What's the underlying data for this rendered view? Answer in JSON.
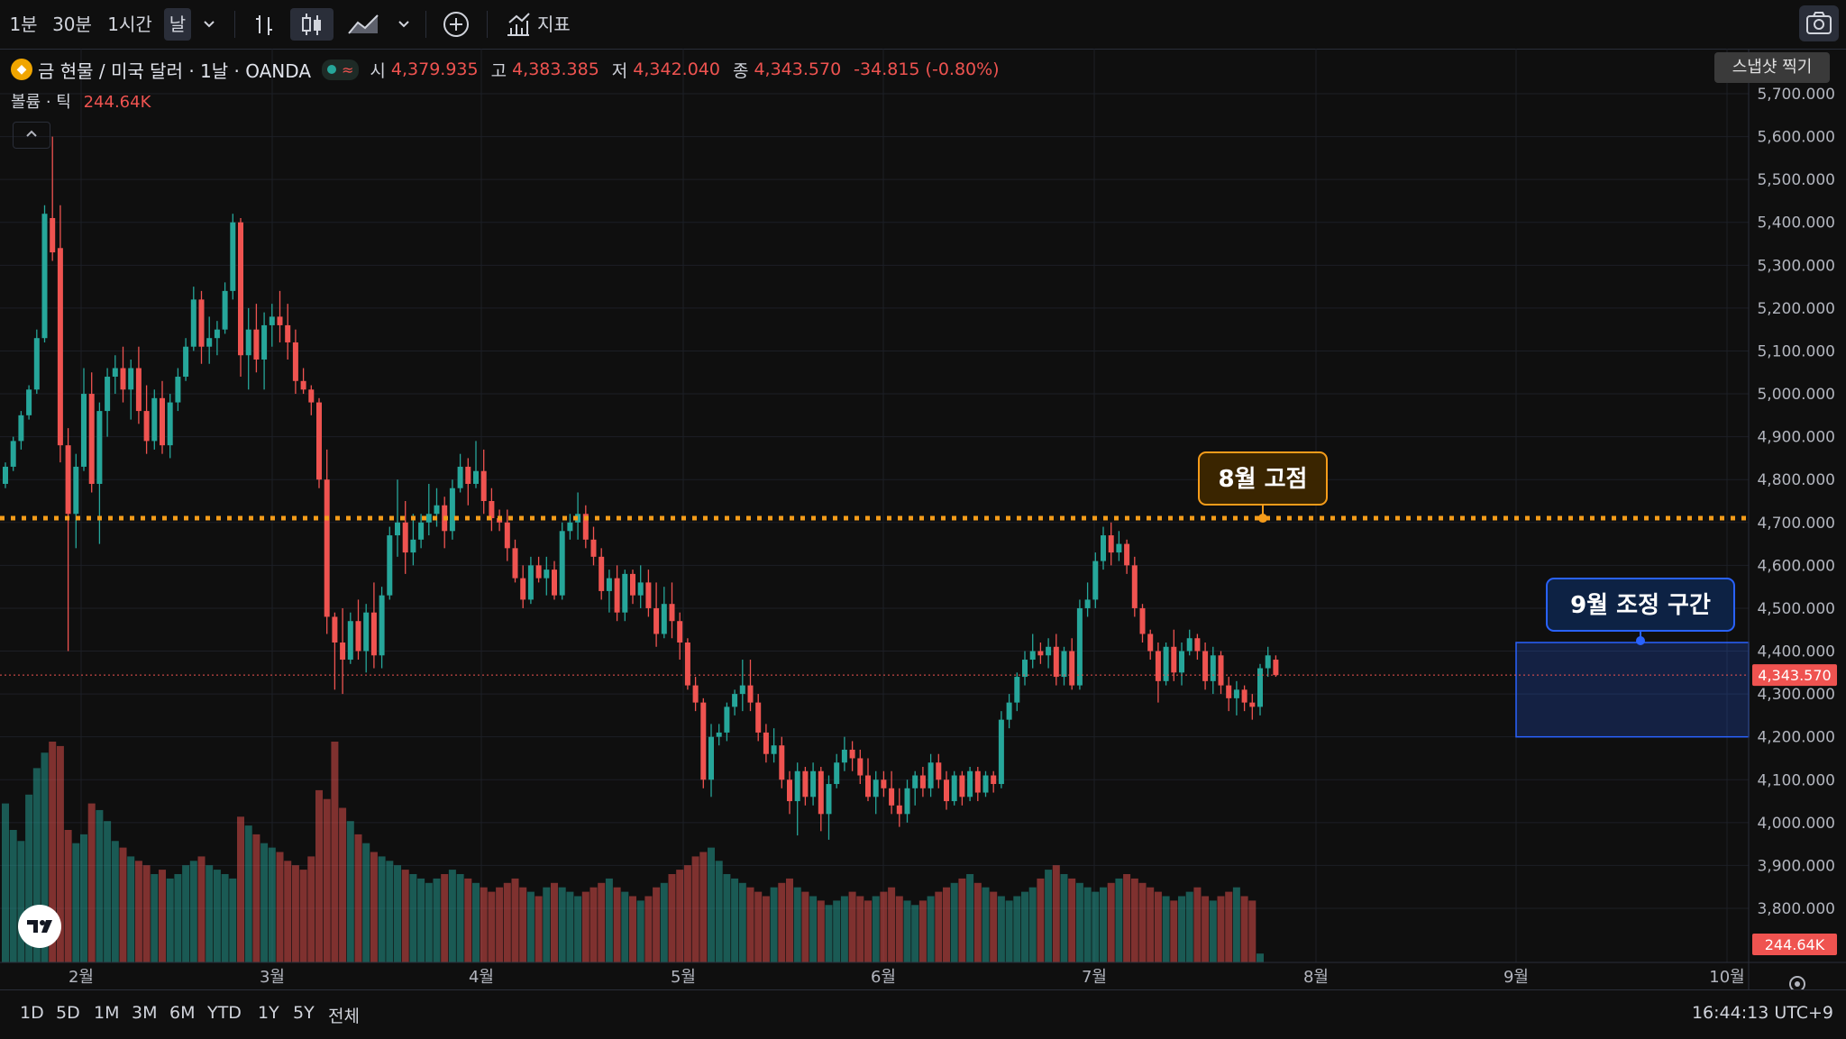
{
  "toolbar": {
    "intervals": [
      "1분",
      "30분",
      "1시간",
      "날"
    ],
    "indicators_label": "지표",
    "icons": [
      "chevron-down-icon",
      "bar-style-icon",
      "candle-style-icon",
      "area-style-icon",
      "chevron-down-icon",
      "add-compare-icon",
      "indicators-icon",
      "camera-icon"
    ]
  },
  "legend": {
    "symbol": "금 현물 / 미국 달러 · 1날 · OANDA",
    "open_label": "시",
    "open": "4,379.935",
    "high_label": "고",
    "high": "4,383.385",
    "low_label": "저",
    "low": "4,342.040",
    "close_label": "종",
    "close": "4,343.570",
    "change": "-34.815 (-0.80%)"
  },
  "volume": {
    "label": "볼륨 · 틱",
    "value": "244.64K"
  },
  "snapshot_tooltip": "스냅샷 찍기",
  "annotations": {
    "aug_high": "8월 고점",
    "sep_correction": "9월 조정 구간"
  },
  "price_axis": {
    "labels": [
      "5,700.000",
      "5,600.000",
      "5,500.000",
      "5,400.000",
      "5,300.000",
      "5,200.000",
      "5,100.000",
      "5,000.000",
      "4,900.000",
      "4,800.000",
      "4,700.000",
      "4,600.000",
      "4,500.000",
      "4,400.000",
      "4,300.000",
      "4,200.000",
      "4,100.000",
      "4,000.000",
      "3,900.000",
      "3,800.000"
    ],
    "last_price": "4,343.570",
    "last_volume": "244.64K"
  },
  "time_axis": [
    "2월",
    "3월",
    "4월",
    "5월",
    "6월",
    "7월",
    "8월",
    "9월",
    "10월"
  ],
  "bottom_bar": {
    "ranges": [
      "1D",
      "5D",
      "1M",
      "3M",
      "6M",
      "YTD",
      "1Y",
      "5Y",
      "전체"
    ],
    "clock": "16:44:13 UTC+9"
  },
  "colors": {
    "up": "#26a69a",
    "down": "#ef5350",
    "accent": "#f59c1a",
    "zone": "#2962ff"
  },
  "chart_data": {
    "type": "candlestick",
    "title": "금 현물 / 미국 달러 · 1날 · OANDA",
    "ylim": [
      3800,
      5700
    ],
    "resistance_level": 4710,
    "correction_zone": {
      "price_low": 4200,
      "price_high": 4420
    },
    "candles_ohlc": [
      [
        4790,
        4840,
        4780,
        4830
      ],
      [
        4830,
        4900,
        4820,
        4890
      ],
      [
        4890,
        4960,
        4870,
        4950
      ],
      [
        4950,
        5020,
        4940,
        5010
      ],
      [
        5010,
        5150,
        5000,
        5130
      ],
      [
        5130,
        5440,
        5120,
        5420
      ],
      [
        5410,
        5600,
        5310,
        5330
      ],
      [
        5340,
        5440,
        4840,
        4880
      ],
      [
        4880,
        4920,
        4400,
        4720
      ],
      [
        4720,
        4860,
        4640,
        4830
      ],
      [
        4830,
        5060,
        4820,
        5000
      ],
      [
        5000,
        5050,
        4770,
        4790
      ],
      [
        4790,
        4980,
        4650,
        4960
      ],
      [
        4960,
        5060,
        4900,
        5040
      ],
      [
        5040,
        5090,
        5000,
        5060
      ],
      [
        5060,
        5110,
        4980,
        5010
      ],
      [
        5010,
        5080,
        4940,
        5060
      ],
      [
        5060,
        5110,
        4930,
        4960
      ],
      [
        4960,
        5020,
        4860,
        4890
      ],
      [
        4890,
        5010,
        4870,
        4990
      ],
      [
        4990,
        5030,
        4860,
        4880
      ],
      [
        4880,
        5000,
        4850,
        4980
      ],
      [
        4980,
        5060,
        4960,
        5040
      ],
      [
        5040,
        5130,
        5030,
        5110
      ],
      [
        5110,
        5250,
        5100,
        5220
      ],
      [
        5220,
        5240,
        5070,
        5110
      ],
      [
        5110,
        5180,
        5070,
        5130
      ],
      [
        5130,
        5170,
        5090,
        5150
      ],
      [
        5150,
        5260,
        5140,
        5240
      ],
      [
        5240,
        5420,
        5220,
        5400
      ],
      [
        5400,
        5410,
        5040,
        5090
      ],
      [
        5090,
        5200,
        5010,
        5150
      ],
      [
        5150,
        5210,
        5050,
        5080
      ],
      [
        5080,
        5190,
        5010,
        5160
      ],
      [
        5160,
        5210,
        5110,
        5180
      ],
      [
        5180,
        5240,
        5120,
        5160
      ],
      [
        5160,
        5210,
        5080,
        5120
      ],
      [
        5120,
        5150,
        5000,
        5030
      ],
      [
        5030,
        5060,
        5000,
        5010
      ],
      [
        5010,
        5020,
        4950,
        4980
      ],
      [
        4980,
        4990,
        4780,
        4800
      ],
      [
        4800,
        4870,
        4440,
        4480
      ],
      [
        4480,
        4490,
        4310,
        4420
      ],
      [
        4420,
        4500,
        4300,
        4380
      ],
      [
        4380,
        4490,
        4370,
        4470
      ],
      [
        4470,
        4520,
        4380,
        4400
      ],
      [
        4400,
        4510,
        4350,
        4490
      ],
      [
        4490,
        4560,
        4360,
        4390
      ],
      [
        4390,
        4550,
        4360,
        4530
      ],
      [
        4530,
        4690,
        4520,
        4670
      ],
      [
        4670,
        4800,
        4620,
        4700
      ],
      [
        4700,
        4750,
        4580,
        4630
      ],
      [
        4630,
        4720,
        4600,
        4660
      ],
      [
        4660,
        4720,
        4640,
        4700
      ],
      [
        4700,
        4790,
        4670,
        4720
      ],
      [
        4720,
        4780,
        4690,
        4740
      ],
      [
        4740,
        4760,
        4640,
        4680
      ],
      [
        4680,
        4800,
        4660,
        4780
      ],
      [
        4780,
        4860,
        4770,
        4830
      ],
      [
        4830,
        4850,
        4740,
        4790
      ],
      [
        4790,
        4890,
        4780,
        4820
      ],
      [
        4820,
        4870,
        4720,
        4750
      ],
      [
        4750,
        4780,
        4680,
        4710
      ],
      [
        4710,
        4730,
        4680,
        4700
      ],
      [
        4700,
        4730,
        4610,
        4640
      ],
      [
        4640,
        4660,
        4560,
        4570
      ],
      [
        4570,
        4600,
        4500,
        4520
      ],
      [
        4520,
        4620,
        4510,
        4600
      ],
      [
        4600,
        4620,
        4560,
        4570
      ],
      [
        4570,
        4620,
        4530,
        4590
      ],
      [
        4590,
        4610,
        4520,
        4530
      ],
      [
        4530,
        4700,
        4520,
        4680
      ],
      [
        4680,
        4720,
        4660,
        4700
      ],
      [
        4700,
        4770,
        4660,
        4720
      ],
      [
        4720,
        4740,
        4640,
        4660
      ],
      [
        4660,
        4690,
        4600,
        4620
      ],
      [
        4620,
        4640,
        4520,
        4540
      ],
      [
        4540,
        4590,
        4490,
        4570
      ],
      [
        4570,
        4600,
        4470,
        4490
      ],
      [
        4490,
        4590,
        4470,
        4580
      ],
      [
        4580,
        4590,
        4510,
        4530
      ],
      [
        4530,
        4600,
        4500,
        4560
      ],
      [
        4560,
        4590,
        4480,
        4500
      ],
      [
        4500,
        4560,
        4410,
        4440
      ],
      [
        4440,
        4550,
        4430,
        4510
      ],
      [
        4510,
        4560,
        4430,
        4470
      ],
      [
        4470,
        4490,
        4380,
        4420
      ],
      [
        4420,
        4430,
        4310,
        4320
      ],
      [
        4320,
        4340,
        4260,
        4280
      ],
      [
        4280,
        4290,
        4080,
        4100
      ],
      [
        4100,
        4230,
        4060,
        4200
      ],
      [
        4200,
        4230,
        4180,
        4210
      ],
      [
        4210,
        4280,
        4190,
        4270
      ],
      [
        4270,
        4310,
        4250,
        4300
      ],
      [
        4300,
        4380,
        4260,
        4320
      ],
      [
        4320,
        4380,
        4260,
        4280
      ],
      [
        4280,
        4300,
        4190,
        4210
      ],
      [
        4210,
        4230,
        4140,
        4160
      ],
      [
        4160,
        4220,
        4140,
        4180
      ],
      [
        4180,
        4200,
        4080,
        4100
      ],
      [
        4100,
        4120,
        4020,
        4050
      ],
      [
        4050,
        4140,
        3970,
        4120
      ],
      [
        4120,
        4130,
        4040,
        4060
      ],
      [
        4060,
        4140,
        4040,
        4120
      ],
      [
        4120,
        4130,
        3980,
        4020
      ],
      [
        4020,
        4110,
        3960,
        4090
      ],
      [
        4090,
        4160,
        4080,
        4140
      ],
      [
        4140,
        4200,
        4120,
        4170
      ],
      [
        4170,
        4190,
        4120,
        4150
      ],
      [
        4150,
        4170,
        4090,
        4110
      ],
      [
        4110,
        4150,
        4050,
        4060
      ],
      [
        4060,
        4120,
        4020,
        4100
      ],
      [
        4100,
        4120,
        4060,
        4080
      ],
      [
        4080,
        4120,
        4020,
        4040
      ],
      [
        4040,
        4080,
        3990,
        4020
      ],
      [
        4020,
        4100,
        4000,
        4080
      ],
      [
        4080,
        4120,
        4040,
        4110
      ],
      [
        4110,
        4130,
        4060,
        4080
      ],
      [
        4080,
        4160,
        4060,
        4140
      ],
      [
        4140,
        4160,
        4080,
        4100
      ],
      [
        4100,
        4120,
        4030,
        4050
      ],
      [
        4050,
        4120,
        4040,
        4110
      ],
      [
        4110,
        4120,
        4040,
        4060
      ],
      [
        4060,
        4130,
        4050,
        4120
      ],
      [
        4120,
        4130,
        4050,
        4070
      ],
      [
        4070,
        4120,
        4060,
        4110
      ],
      [
        4110,
        4120,
        4070,
        4090
      ],
      [
        4090,
        4260,
        4080,
        4240
      ],
      [
        4240,
        4300,
        4220,
        4280
      ],
      [
        4280,
        4350,
        4260,
        4340
      ],
      [
        4340,
        4400,
        4320,
        4380
      ],
      [
        4380,
        4440,
        4360,
        4400
      ],
      [
        4400,
        4420,
        4370,
        4390
      ],
      [
        4390,
        4430,
        4360,
        4410
      ],
      [
        4410,
        4440,
        4320,
        4340
      ],
      [
        4340,
        4410,
        4320,
        4400
      ],
      [
        4400,
        4430,
        4310,
        4320
      ],
      [
        4320,
        4520,
        4310,
        4500
      ],
      [
        4500,
        4560,
        4480,
        4520
      ],
      [
        4520,
        4630,
        4500,
        4610
      ],
      [
        4610,
        4690,
        4590,
        4670
      ],
      [
        4670,
        4700,
        4600,
        4630
      ],
      [
        4630,
        4680,
        4610,
        4650
      ],
      [
        4650,
        4660,
        4580,
        4600
      ],
      [
        4600,
        4620,
        4480,
        4500
      ],
      [
        4500,
        4510,
        4420,
        4440
      ],
      [
        4440,
        4450,
        4380,
        4400
      ],
      [
        4400,
        4420,
        4280,
        4330
      ],
      [
        4330,
        4420,
        4320,
        4410
      ],
      [
        4410,
        4450,
        4330,
        4350
      ],
      [
        4350,
        4420,
        4320,
        4400
      ],
      [
        4400,
        4450,
        4390,
        4430
      ],
      [
        4430,
        4440,
        4380,
        4400
      ],
      [
        4400,
        4420,
        4310,
        4330
      ],
      [
        4330,
        4410,
        4300,
        4390
      ],
      [
        4390,
        4400,
        4300,
        4320
      ],
      [
        4320,
        4340,
        4260,
        4290
      ],
      [
        4290,
        4330,
        4250,
        4310
      ],
      [
        4310,
        4320,
        4260,
        4280
      ],
      [
        4280,
        4300,
        4240,
        4270
      ],
      [
        4270,
        4370,
        4250,
        4360
      ],
      [
        4360,
        4410,
        4340,
        4390
      ],
      [
        4380,
        4390,
        4340,
        4344
      ]
    ],
    "volumes": [
      72,
      60,
      55,
      76,
      88,
      95,
      100,
      98,
      60,
      54,
      58,
      72,
      69,
      64,
      55,
      52,
      48,
      46,
      44,
      40,
      42,
      38,
      40,
      44,
      46,
      48,
      44,
      42,
      40,
      38,
      66,
      62,
      58,
      54,
      52,
      50,
      46,
      44,
      42,
      48,
      78,
      74,
      100,
      70,
      64,
      58,
      54,
      50,
      48,
      46,
      44,
      42,
      40,
      38,
      36,
      38,
      40,
      42,
      40,
      38,
      36,
      34,
      32,
      34,
      36,
      38,
      34,
      32,
      30,
      34,
      36,
      34,
      32,
      30,
      32,
      34,
      36,
      38,
      34,
      32,
      30,
      28,
      30,
      34,
      36,
      40,
      42,
      44,
      48,
      50,
      52,
      46,
      40,
      38,
      36,
      34,
      32,
      30,
      34,
      36,
      38,
      34,
      32,
      30,
      28,
      26,
      28,
      30,
      32,
      30,
      28,
      30,
      32,
      34,
      30,
      28,
      26,
      28,
      30,
      32,
      34,
      36,
      38,
      40,
      36,
      34,
      32,
      30,
      28,
      30,
      32,
      34,
      38,
      42,
      44,
      40,
      38,
      36,
      34,
      32,
      34,
      36,
      38,
      40,
      38,
      36,
      34,
      32,
      30,
      28,
      30,
      32,
      34,
      30,
      28,
      30,
      32,
      34,
      30,
      28,
      4
    ]
  }
}
